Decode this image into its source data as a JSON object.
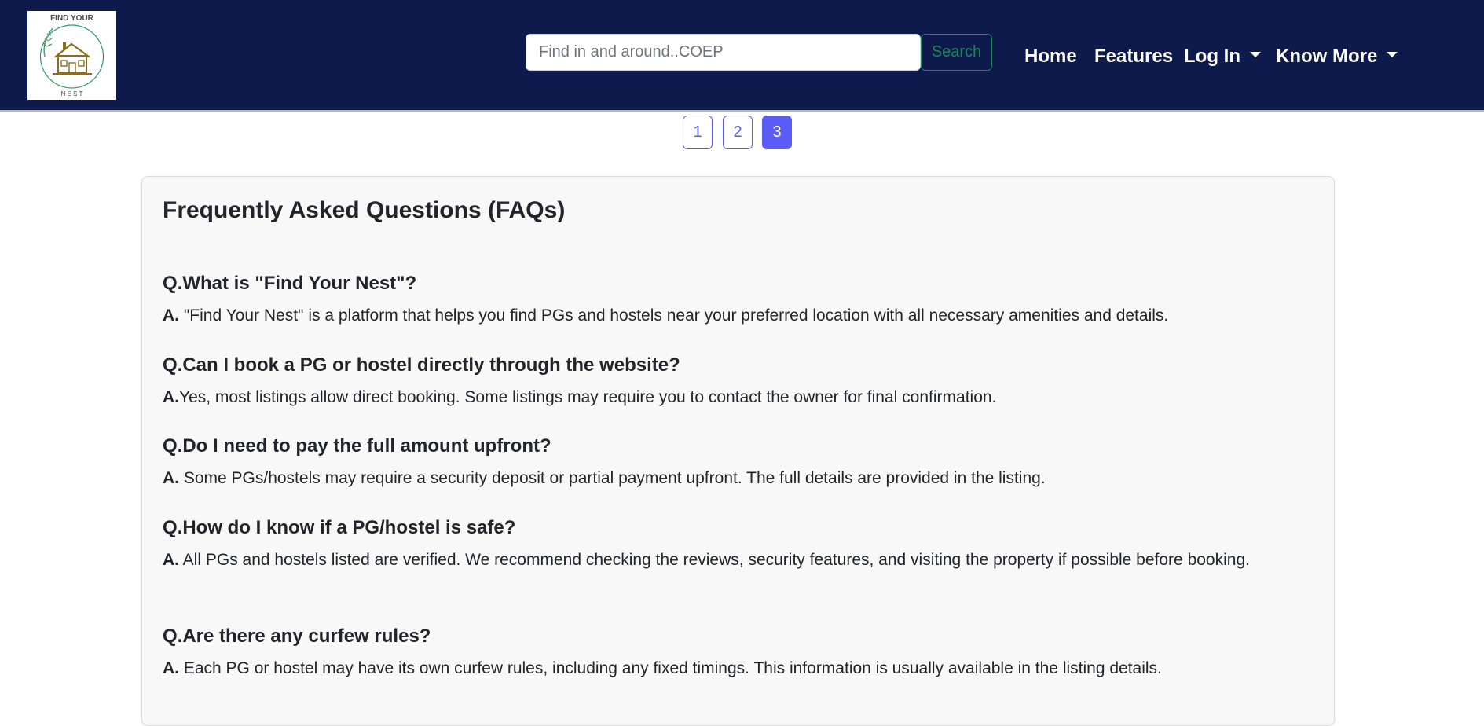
{
  "brand": {
    "logo_top_text": "FIND YOUR",
    "logo_bottom_text": "N E S T"
  },
  "search": {
    "placeholder": "Find in and around..COEP",
    "button_label": "Search"
  },
  "nav": {
    "home": "Home",
    "features": "Features",
    "login": "Log In",
    "know_more": "Know More"
  },
  "pagination": {
    "pages": [
      "1",
      "2",
      "3"
    ],
    "active": "3"
  },
  "faq": {
    "title": "Frequently Asked Questions (FAQs)",
    "items": [
      {
        "q": "Q.What is \"Find Your Nest\"?",
        "a_prefix": "A.",
        "a": " \"Find Your Nest\" is a platform that helps you find PGs and hostels near your preferred location with all necessary amenities and details."
      },
      {
        "q": "Q.Can I book a PG or hostel directly through the website?",
        "a_prefix": "A.",
        "a": "Yes, most listings allow direct booking. Some listings may require you to contact the owner for final confirmation."
      },
      {
        "q": "Q.Do I need to pay the full amount upfront?",
        "a_prefix": "A.",
        "a": " Some PGs/hostels may require a security deposit or partial payment upfront. The full details are provided in the listing."
      },
      {
        "q": "Q.How do I know if a PG/hostel is safe?",
        "a_prefix": "A.",
        "a": " All PGs and hostels listed are verified. We recommend checking the reviews, security features, and visiting the property if possible before booking."
      },
      {
        "q": "Q.Are there any curfew rules?",
        "a_prefix": "A.",
        "a": " Each PG or hostel may have its own curfew rules, including any fixed timings. This information is usually available in the listing details."
      }
    ]
  },
  "colors": {
    "navbar_bg": "#0d1a4b",
    "search_green": "#198754",
    "page_accent": "#5b5bf5",
    "card_bg": "#f8f8f8"
  }
}
